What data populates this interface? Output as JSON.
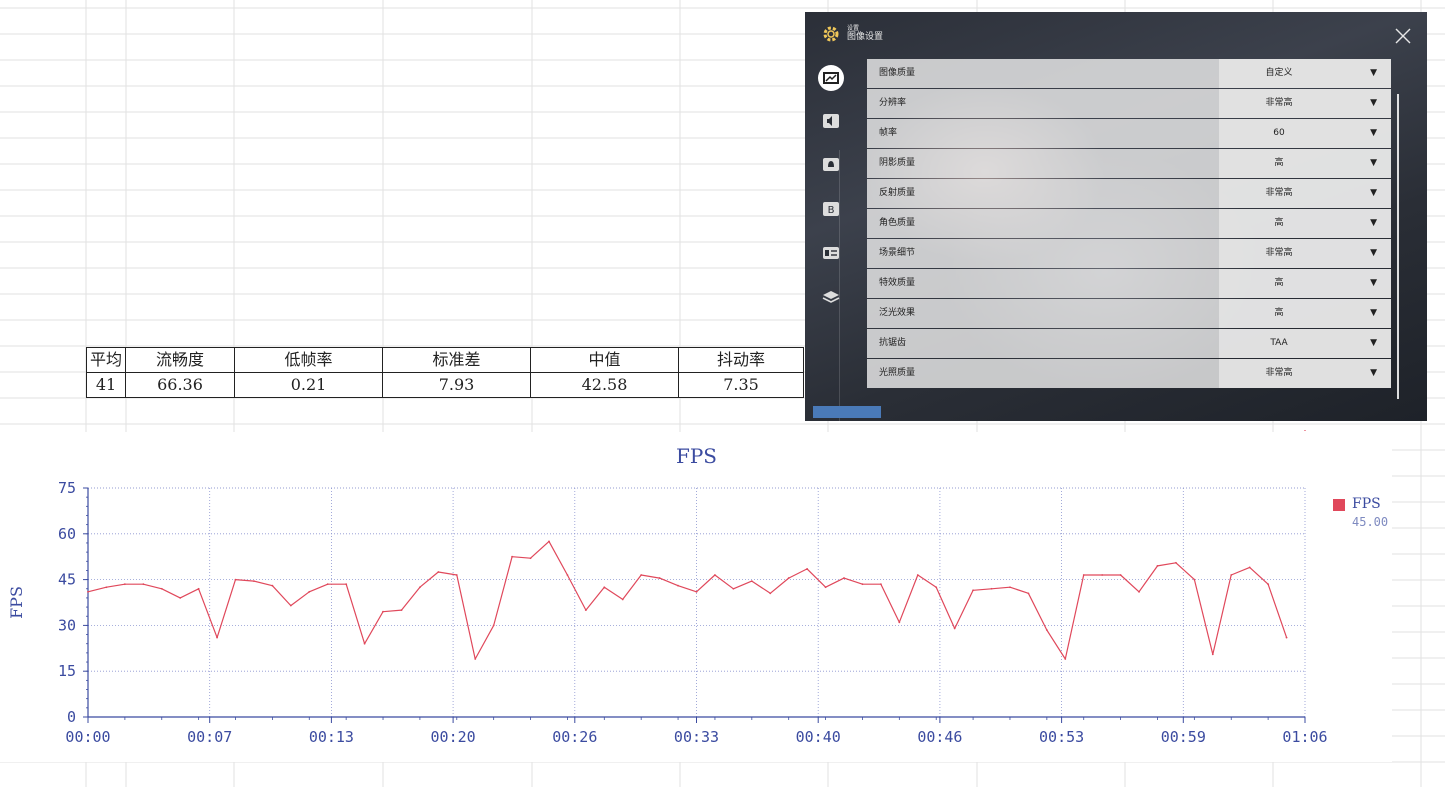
{
  "stats": {
    "headers": [
      "平均",
      "流畅度",
      "低帧率",
      "标准差",
      "中值",
      "抖动率"
    ],
    "values": [
      "41",
      "66.36",
      "0.21",
      "7.93",
      "42.58",
      "7.35"
    ]
  },
  "settings": {
    "title_small": "设置",
    "title": "图像设置",
    "close_icon": "close-icon",
    "rail_icons": [
      "display-icon",
      "sound-icon",
      "notification-icon",
      "account-icon",
      "card-icon",
      "layers-icon"
    ],
    "rows": [
      {
        "label": "图像质量",
        "value": "自定义"
      },
      {
        "label": "分辨率",
        "value": "非常高"
      },
      {
        "label": "帧率",
        "value": "60"
      },
      {
        "label": "阴影质量",
        "value": "高"
      },
      {
        "label": "反射质量",
        "value": "非常高"
      },
      {
        "label": "角色质量",
        "value": "高"
      },
      {
        "label": "场景细节",
        "value": "非常高"
      },
      {
        "label": "特效质量",
        "value": "高"
      },
      {
        "label": "泛光效果",
        "value": "高"
      },
      {
        "label": "抗锯齿",
        "value": "TAA"
      },
      {
        "label": "光照质量",
        "value": "非常高"
      }
    ]
  },
  "chart_data": {
    "type": "line",
    "title": "FPS",
    "ylabel": "FPS",
    "xlabel": "",
    "ylim": [
      0,
      75
    ],
    "yticks": [
      0,
      15,
      30,
      45,
      60,
      75
    ],
    "xlim_seconds": [
      0,
      66
    ],
    "xtick_labels": [
      "00:00",
      "00:07",
      "00:13",
      "00:20",
      "00:26",
      "00:33",
      "00:40",
      "00:46",
      "00:53",
      "00:59",
      "01:06"
    ],
    "grid": true,
    "legend_position": "right",
    "series": [
      {
        "name": "FPS",
        "color": "#e0485b",
        "legend_value": "45.00",
        "x_seconds": [
          0,
          1,
          2,
          3,
          4,
          5,
          6,
          7,
          8,
          9,
          10,
          11,
          12,
          13,
          14,
          15,
          16,
          17,
          18,
          19,
          20,
          21,
          22,
          23,
          24,
          25,
          26,
          27,
          28,
          29,
          30,
          31,
          32,
          33,
          34,
          35,
          36,
          37,
          38,
          39,
          40,
          41,
          42,
          43,
          44,
          45,
          46,
          47,
          48,
          49,
          50,
          51,
          52,
          53,
          54,
          55,
          56,
          57,
          58,
          59,
          60,
          61,
          62,
          63,
          64,
          65,
          66
        ],
        "values": [
          41,
          42.5,
          43.5,
          43.5,
          42,
          39,
          42,
          26,
          45,
          44.5,
          43,
          36.5,
          41,
          43.5,
          43.5,
          24,
          34.5,
          35,
          42.5,
          47.5,
          46.5,
          19,
          30,
          52.5,
          52,
          57.5,
          46.5,
          35,
          42.5,
          38.5,
          46.5,
          45.5,
          43,
          41,
          46.5,
          42,
          44.5,
          40.5,
          45.5,
          48.5,
          42.5,
          45.5,
          43.5,
          43.5,
          31,
          46.5,
          42.5,
          29,
          41.5,
          42,
          42.5,
          40.5,
          28.5,
          19,
          46.5,
          46.5,
          46.5,
          41,
          49.5,
          50.5,
          45,
          20.5,
          46.5,
          49,
          43.5,
          26
        ]
      }
    ]
  }
}
